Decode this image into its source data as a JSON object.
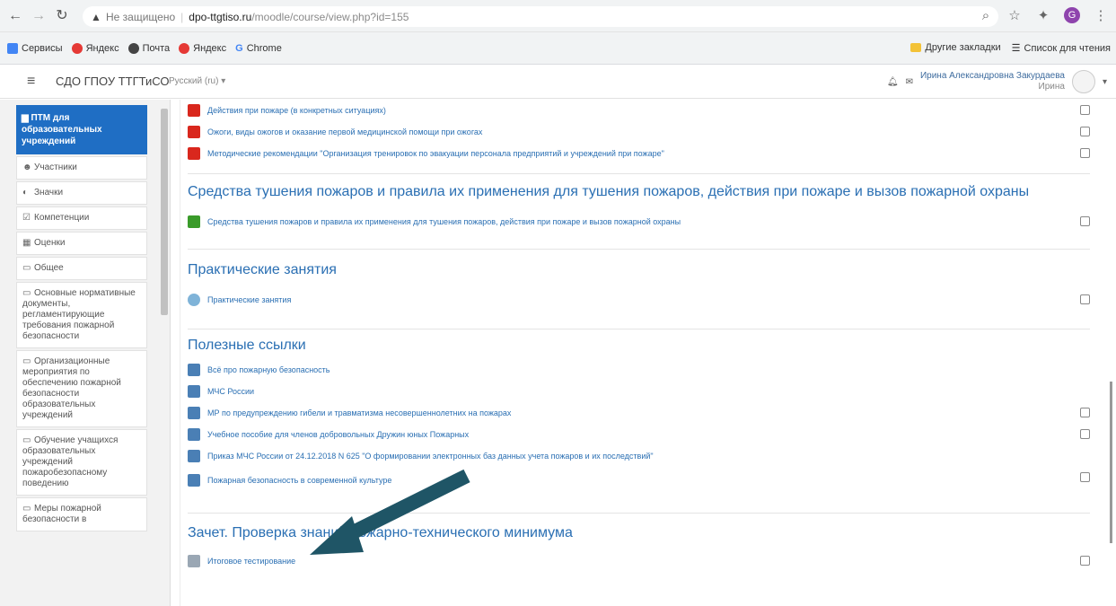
{
  "browser": {
    "not_secure": "Не защищено",
    "host": "dpo-ttgtiso.ru",
    "path": "/moodle/course/view.php?id=155",
    "bookmarks": [
      "Сервисы",
      "Яндекс",
      "Почта",
      "Яндекс",
      "Chrome"
    ],
    "bookmarks_right": [
      "Другие закладки",
      "Список для чтения"
    ],
    "profile_letter": "G"
  },
  "navbar": {
    "site": "СДО ГПОУ ТТГТиСО",
    "lang": "Русский (ru) ▾",
    "user": "Ирина Александровна Закурдаева",
    "user_sub": "Ирина"
  },
  "drawer": {
    "active": "ПТМ для образовательных учреждений",
    "items": [
      {
        "icon": "participants-icon",
        "label": "Участники"
      },
      {
        "icon": "badge-icon",
        "label": "Значки"
      },
      {
        "icon": "competency-icon",
        "label": "Компетенции"
      },
      {
        "icon": "grades-icon",
        "label": "Оценки"
      },
      {
        "icon": "folder-icon",
        "label": "Общее"
      },
      {
        "icon": "folder-icon",
        "label": "Основные нормативные документы, регламентирующие требования пожарной безопасности"
      },
      {
        "icon": "folder-icon",
        "label": "Организационные мероприятия по обеспечению пожарной безопасности образовательных учреждений"
      },
      {
        "icon": "folder-icon",
        "label": "Обучение учащихся образовательных учреждений пожаробезопасному поведению"
      },
      {
        "icon": "folder-icon",
        "label": "Меры пожарной безопасности в"
      }
    ]
  },
  "sections": [
    {
      "title": "",
      "activities": [
        {
          "icon": "pdf-icon",
          "label": "Действия при пожаре (в конкретных ситуациях)"
        },
        {
          "icon": "pdf-icon",
          "label": "Ожоги, виды ожогов и оказание первой медицинской помощи при ожогах"
        },
        {
          "icon": "pdf-icon",
          "label": "Методические рекомендации \"Организация тренировок по эвакуации персонала предприятий и учреждений при пожаре\""
        }
      ]
    },
    {
      "title": "Средства тушения пожаров и правила их применения для тушения пожаров, действия при пожаре и вызов пожарной охраны",
      "activities": [
        {
          "icon": "book-icon",
          "label": "Средства тушения пожаров и правила их применения для тушения пожаров, действия при пожаре и вызов пожарной охраны"
        }
      ]
    },
    {
      "title": "Практические занятия",
      "activities": [
        {
          "icon": "lesson-icon",
          "label": "Практические занятия"
        }
      ]
    },
    {
      "title": "Полезные ссылки",
      "activities": [
        {
          "icon": "url-icon",
          "label": "Всё про пожарную безопасность"
        },
        {
          "icon": "url-icon",
          "label": "МЧС России"
        },
        {
          "icon": "url-icon",
          "label": "МР по предупреждению гибели и травматизма несовершеннолетних на пожарах"
        },
        {
          "icon": "url-icon",
          "label": "Учебное пособие для членов добровольных Дружин юных Пожарных"
        },
        {
          "icon": "url-icon",
          "label": "Приказ МЧС России от 24.12.2018 N 625 \"О формировании электронных баз данных учета пожаров и их последствий\""
        },
        {
          "icon": "url-icon",
          "label": "Пожарная безопасность в современной культуре"
        }
      ]
    },
    {
      "title": "Зачет. Проверка знаний пожарно-технического минимума",
      "activities": [
        {
          "icon": "quiz-icon",
          "label": "Итоговое тестирование"
        }
      ]
    }
  ],
  "colors": {
    "accent": "#1f6ec4",
    "link": "#2a6fb3",
    "arrow": "#1f5566"
  }
}
